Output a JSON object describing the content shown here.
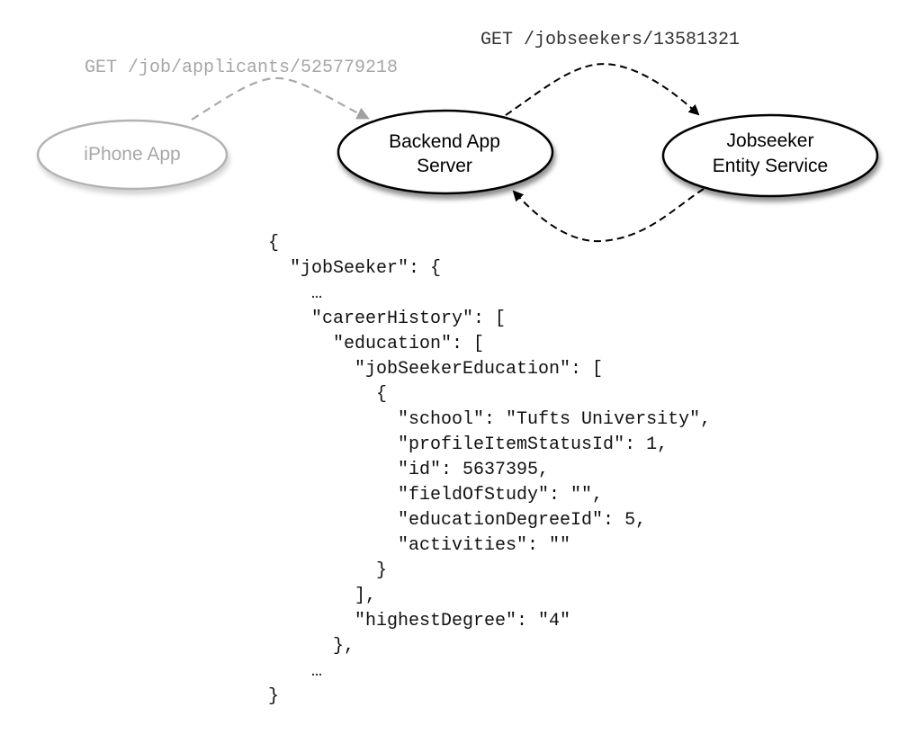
{
  "diagram": {
    "nodes": [
      {
        "id": "iphone",
        "label_lines": [
          "iPhone App"
        ],
        "style": "faded"
      },
      {
        "id": "backend",
        "label_lines": [
          "Backend App",
          "Server"
        ],
        "style": "solid"
      },
      {
        "id": "jobseeker",
        "label_lines": [
          "Jobseeker",
          "Entity Service"
        ],
        "style": "solid"
      }
    ],
    "requests": [
      {
        "from": "iphone",
        "to": "backend",
        "label": "GET /job/applicants/525779218",
        "style": "faded"
      },
      {
        "from": "backend",
        "to": "jobseeker",
        "label": "GET /jobseekers/13581321",
        "style": "solid"
      },
      {
        "from": "jobseeker",
        "to": "backend",
        "label": "",
        "style": "solid"
      }
    ]
  },
  "response_json_lines": [
    {
      "indent": 0,
      "text": "{"
    },
    {
      "indent": 1,
      "text": "\"jobSeeker\": {"
    },
    {
      "indent": 2,
      "text": "…"
    },
    {
      "indent": 2,
      "text": "\"careerHistory\": ["
    },
    {
      "indent": 3,
      "text": "\"education\": ["
    },
    {
      "indent": 4,
      "text": "\"jobSeekerEducation\": ["
    },
    {
      "indent": 5,
      "text": "{"
    },
    {
      "indent": 6,
      "text": "\"school\": \"Tufts University\","
    },
    {
      "indent": 6,
      "text": "\"profileItemStatusId\": 1,"
    },
    {
      "indent": 6,
      "text": "\"id\": 5637395,"
    },
    {
      "indent": 6,
      "text": "\"fieldOfStudy\": \"\","
    },
    {
      "indent": 6,
      "text": "\"educationDegreeId\": 5,"
    },
    {
      "indent": 6,
      "text": "\"activities\": \"\""
    },
    {
      "indent": 5,
      "text": "}"
    },
    {
      "indent": 4,
      "text": "],"
    },
    {
      "indent": 4,
      "text": "\"highestDegree\": \"4\""
    },
    {
      "indent": 3,
      "text": "},"
    },
    {
      "indent": 2,
      "text": "…"
    },
    {
      "indent": 0,
      "text": "}"
    }
  ],
  "colors": {
    "solid_stroke": "#000000",
    "faded_stroke": "#b0b0b0",
    "faded_text": "#a8a8a8",
    "solid_text": "#000000",
    "route_text_solid": "#333333",
    "route_text_faded": "#a6a6a6"
  }
}
